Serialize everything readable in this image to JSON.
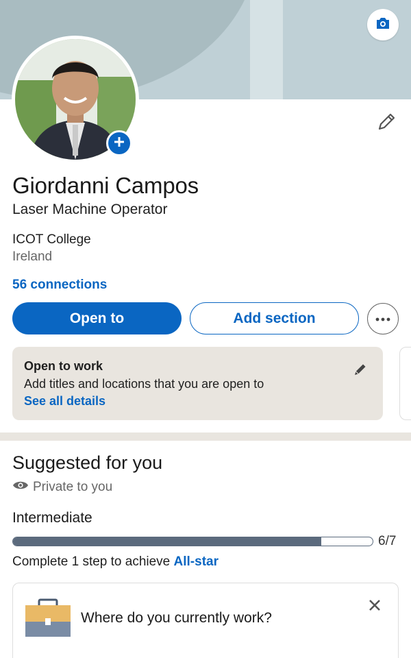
{
  "profile": {
    "name": "Giordanni Campos",
    "headline": "Laser Machine Operator",
    "school": "ICOT College",
    "location": "Ireland",
    "connections": "56 connections"
  },
  "actions": {
    "open_to": "Open to",
    "add_section": "Add section",
    "more_icon": "ellipsis-icon"
  },
  "open_to_work": {
    "title": "Open to work",
    "description": "Add titles and locations that you are open to",
    "link": "See all details"
  },
  "suggested": {
    "title": "Suggested for you",
    "privacy": "Private to you",
    "level": "Intermediate",
    "progress_value": 6,
    "progress_total": 7,
    "progress_text": "6/7",
    "complete_prefix": "Complete 1 step to achieve ",
    "complete_link": "All-star",
    "card_question": "Where do you currently work?"
  },
  "colors": {
    "accent": "#0a66c2",
    "banner": "#bfd0d6",
    "card_bg": "#e9e5df",
    "progress": "#5b6a7d"
  }
}
